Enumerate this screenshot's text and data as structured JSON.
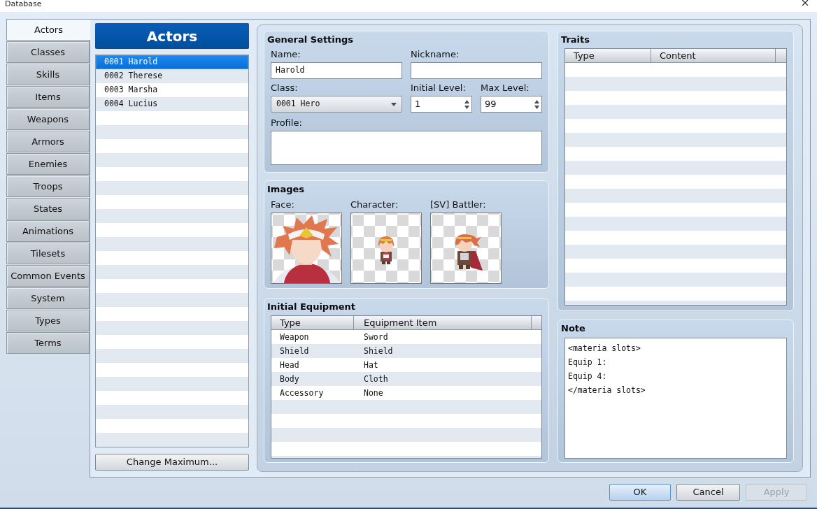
{
  "window": {
    "title": "Database"
  },
  "tabs": [
    {
      "label": "Actors",
      "selected": true
    },
    {
      "label": "Classes",
      "selected": false
    },
    {
      "label": "Skills",
      "selected": false
    },
    {
      "label": "Items",
      "selected": false
    },
    {
      "label": "Weapons",
      "selected": false
    },
    {
      "label": "Armors",
      "selected": false
    },
    {
      "label": "Enemies",
      "selected": false
    },
    {
      "label": "Troops",
      "selected": false
    },
    {
      "label": "States",
      "selected": false
    },
    {
      "label": "Animations",
      "selected": false
    },
    {
      "label": "Tilesets",
      "selected": false
    },
    {
      "label": "Common Events",
      "selected": false
    },
    {
      "label": "System",
      "selected": false
    },
    {
      "label": "Types",
      "selected": false
    },
    {
      "label": "Terms",
      "selected": false
    }
  ],
  "actor_list": {
    "header": "Actors",
    "items": [
      {
        "label": "0001 Harold",
        "selected": true
      },
      {
        "label": "0002 Therese",
        "selected": false
      },
      {
        "label": "0003 Marsha",
        "selected": false
      },
      {
        "label": "0004 Lucius",
        "selected": false
      }
    ],
    "button": "Change Maximum..."
  },
  "general_settings": {
    "title": "General Settings",
    "name": {
      "label": "Name:",
      "value": "Harold"
    },
    "nickname": {
      "label": "Nickname:"
    },
    "class": {
      "label": "Class:",
      "value": "0001 Hero"
    },
    "initial_level": {
      "label": "Initial Level:",
      "value": "1"
    },
    "max_level": {
      "label": "Max Level:",
      "value": "99"
    },
    "profile": {
      "label": "Profile:"
    }
  },
  "images": {
    "title": "Images",
    "slots": [
      {
        "label": "Face:",
        "kind": "face"
      },
      {
        "label": "Character:",
        "kind": "character"
      },
      {
        "label": "[SV] Battler:",
        "kind": "battler"
      }
    ]
  },
  "initial_equipment": {
    "title": "Initial Equipment",
    "columns": [
      "Type",
      "Equipment Item"
    ],
    "rows": [
      [
        "Weapon",
        "Sword"
      ],
      [
        "Shield",
        "Shield"
      ],
      [
        "Head",
        "Hat"
      ],
      [
        "Body",
        "Cloth"
      ],
      [
        "Accessory",
        "None"
      ]
    ]
  },
  "traits": {
    "title": "Traits",
    "columns": [
      "Type",
      "Content"
    ]
  },
  "note": {
    "title": "Note",
    "value": "<materia slots>\nEquip 1:\nEquip 4:\n</materia slots>"
  },
  "buttons": [
    {
      "label": "OK",
      "default": true,
      "disabled": false
    },
    {
      "label": "Cancel",
      "default": false,
      "disabled": false
    },
    {
      "label": "Apply",
      "default": false,
      "disabled": true
    }
  ]
}
